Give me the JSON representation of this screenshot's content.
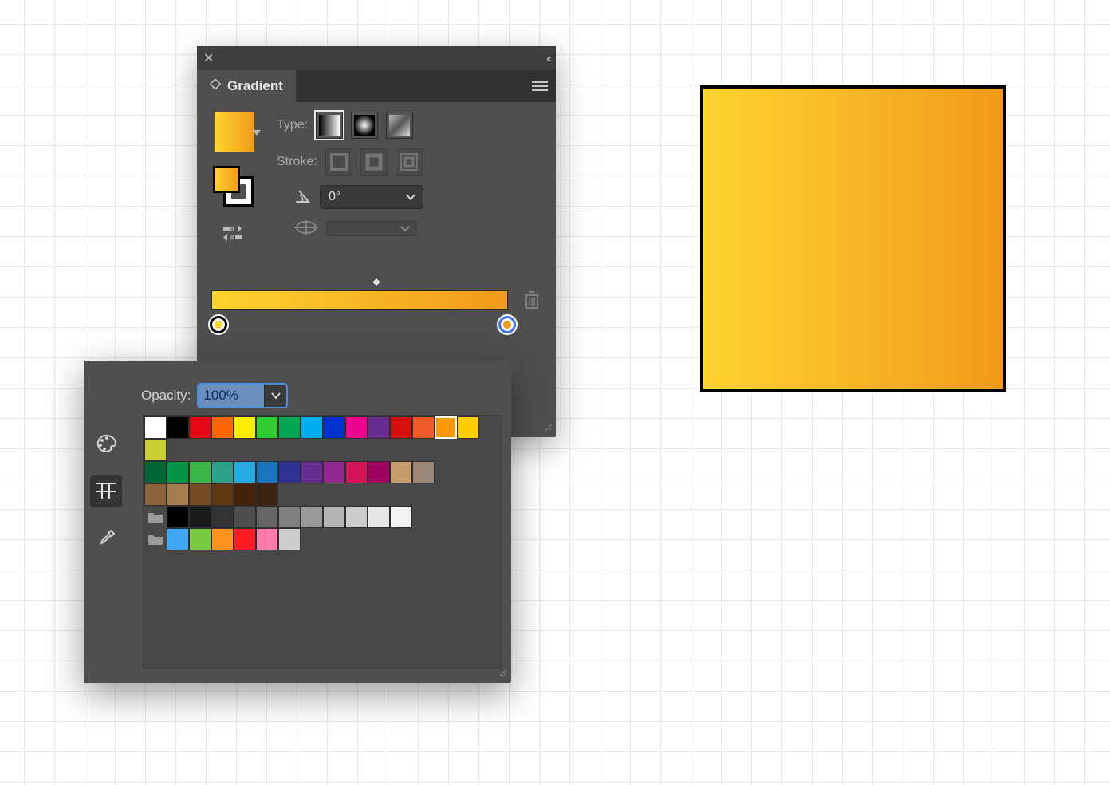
{
  "panel": {
    "title": "Gradient",
    "type_label": "Type:",
    "stroke_label": "Stroke:",
    "angle_value": "0°",
    "gradient_colors": {
      "start": "#ffd430",
      "end": "#f19a1a"
    },
    "selected_stop": "end"
  },
  "popup": {
    "opacity_label": "Opacity:",
    "opacity_value": "100%",
    "left_tabs": {
      "active": "swatches"
    },
    "swatch_rows": {
      "row1": [
        "#ffffff",
        "#000000",
        "#e30613",
        "#ff6600",
        "#ffed00",
        "#33cc33",
        "#00a651",
        "#00aeef",
        "#0033cc",
        "#ec008c",
        "#662d91",
        "#d40f0f",
        "#f15a29",
        "#ff9900",
        "#ffcc00",
        "#cccc33"
      ],
      "row1_selected_index": 13,
      "row2": [
        "#006837",
        "#009245",
        "#39b54a",
        "#2ca089",
        "#27aae1",
        "#1b75bc",
        "#2e3192",
        "#662d91",
        "#92278f",
        "#d4145a",
        "#9e005d",
        "#c69c6d",
        "#998675"
      ],
      "row3": [
        "#8c6239",
        "#a67c52",
        "#754c24",
        "#603913",
        "#42210b",
        "#3b2314"
      ],
      "grays_row": [
        "#000000",
        "#1a1a1a",
        "#333333",
        "#4d4d4d",
        "#666666",
        "#808080",
        "#999999",
        "#b3b3b3",
        "#cccccc",
        "#e6e6e6",
        "#f2f2f2"
      ],
      "last_row": [
        "#3fa9f5",
        "#7ac943",
        "#ff931e",
        "#ff1d25",
        "#ff7bac",
        "#cccccc"
      ]
    }
  },
  "shape": {
    "gradient": {
      "start": "#ffd430",
      "end": "#f19a1a"
    }
  }
}
